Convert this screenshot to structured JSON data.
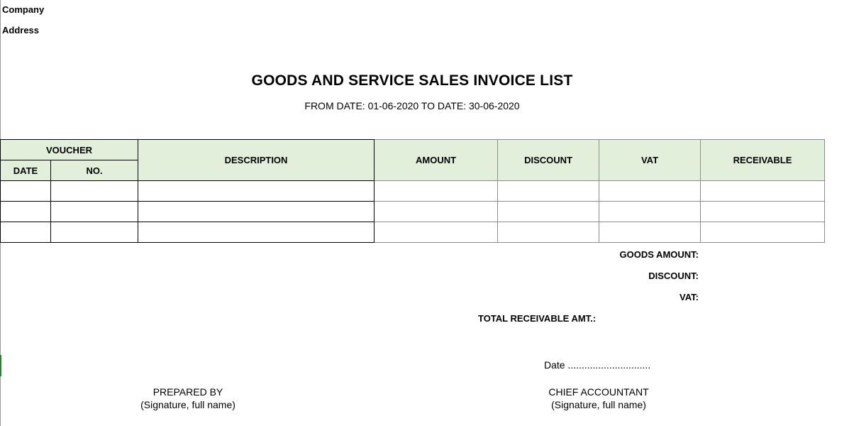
{
  "header": {
    "company_label": "Company",
    "address_label": "Address"
  },
  "title": "GOODS AND SERVICE SALES INVOICE LIST",
  "subtitle": "FROM DATE: 01-06-2020 TO DATE: 30-06-2020",
  "table": {
    "voucher_header": "VOUCHER",
    "date_header": "DATE",
    "no_header": "NO.",
    "description_header": "DESCRIPTION",
    "amount_header": "AMOUNT",
    "discount_header": "DISCOUNT",
    "vat_header": "VAT",
    "receivable_header": "RECEIVABLE",
    "rows": [
      {
        "date": "",
        "no": "",
        "description": "",
        "amount": "",
        "discount": "",
        "vat": "",
        "receivable": ""
      },
      {
        "date": "",
        "no": "",
        "description": "",
        "amount": "",
        "discount": "",
        "vat": "",
        "receivable": ""
      },
      {
        "date": "",
        "no": "",
        "description": "",
        "amount": "",
        "discount": "",
        "vat": "",
        "receivable": ""
      }
    ]
  },
  "summary": {
    "goods_amount_label": "GOODS AMOUNT:",
    "discount_label": "DISCOUNT:",
    "vat_label": "VAT:",
    "total_receivable_label": "TOTAL RECEIVABLE AMT.:"
  },
  "footer": {
    "date_line": "Date ..............................",
    "prepared_by": "PREPARED BY",
    "prepared_by_sub": "(Signature, full name)",
    "chief_accountant": "CHIEF ACCOUNTANT",
    "chief_accountant_sub": "(Signature, full name)"
  },
  "colors": {
    "header_fill": "#e2efda",
    "row_marker": "#2e7d32"
  }
}
